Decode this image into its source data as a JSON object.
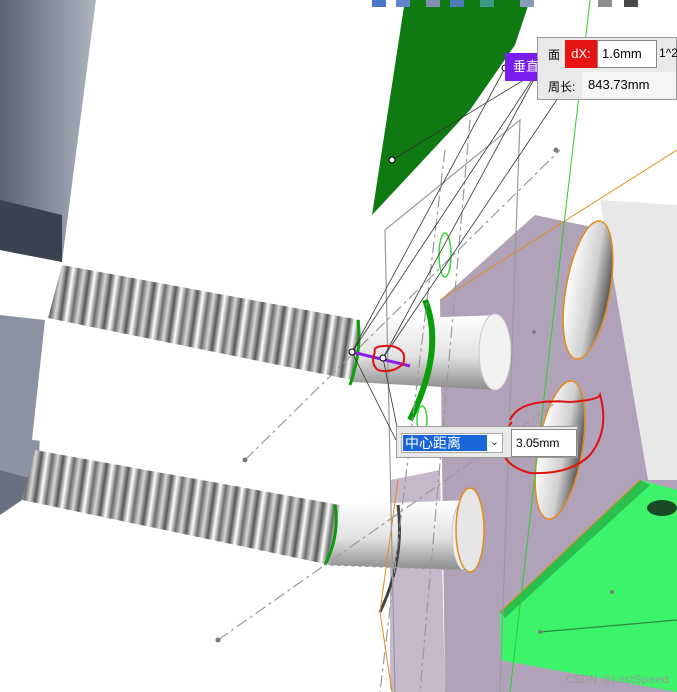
{
  "toolbar": {
    "icons": [
      "arrow-select-icon",
      "pan-icon",
      "view-cube-icon",
      "view-orientation-icon",
      "display-style-icon",
      "section-view-icon",
      "render-icon",
      "more-icon"
    ]
  },
  "measure_panel": {
    "row1_label": "面",
    "dx_label": "dX:",
    "dx_value": "1.6mm",
    "overflow_text": "1^2",
    "row2_label": "周长:",
    "row2_value": "843.73mm"
  },
  "perpendicular_tag": {
    "label": "垂直"
  },
  "center_distance": {
    "selected_option": "中心距离",
    "value": "3.05mm"
  },
  "watermark": {
    "text": "CSDN @LostSpeed"
  },
  "colors": {
    "selection_green": "#0a9e0a",
    "face_green": "#3cf36a",
    "dark_green_face": "#0f7a12",
    "highlight_purple": "#b0a2b8",
    "dx_red": "#e81414",
    "perp_purple": "#7a1ef0",
    "dropdown_blue": "#1a66d9",
    "annotation_red": "#e01010",
    "edge_orange": "#e68a1a"
  }
}
